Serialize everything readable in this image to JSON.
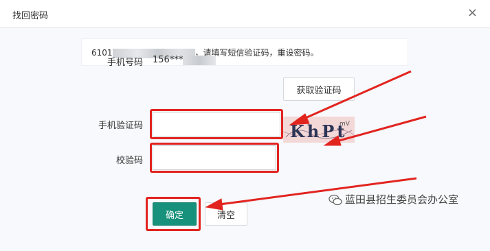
{
  "dialog": {
    "title": "找回密码",
    "close_glyph": "×"
  },
  "notice": {
    "prefix": "6101",
    "suffix": "，请填写短信验证码，重设密码。"
  },
  "form": {
    "phone_label": "手机号码",
    "phone_value": "156***",
    "get_code_button": "获取验证码",
    "sms_code_label": "手机验证码",
    "sms_code_value": "",
    "verify_label": "校验码",
    "verify_value": "",
    "captcha_text": "KhPt",
    "captcha_small_text": "mV",
    "confirm_button": "确定",
    "clear_button": "清空"
  },
  "watermark": {
    "text": "蓝田县招生委员会办公室",
    "icon": "wechat-icon"
  },
  "colors": {
    "primary_button": "#17917b",
    "highlight_box": "#e2241f",
    "arrow": "#e2241f"
  }
}
